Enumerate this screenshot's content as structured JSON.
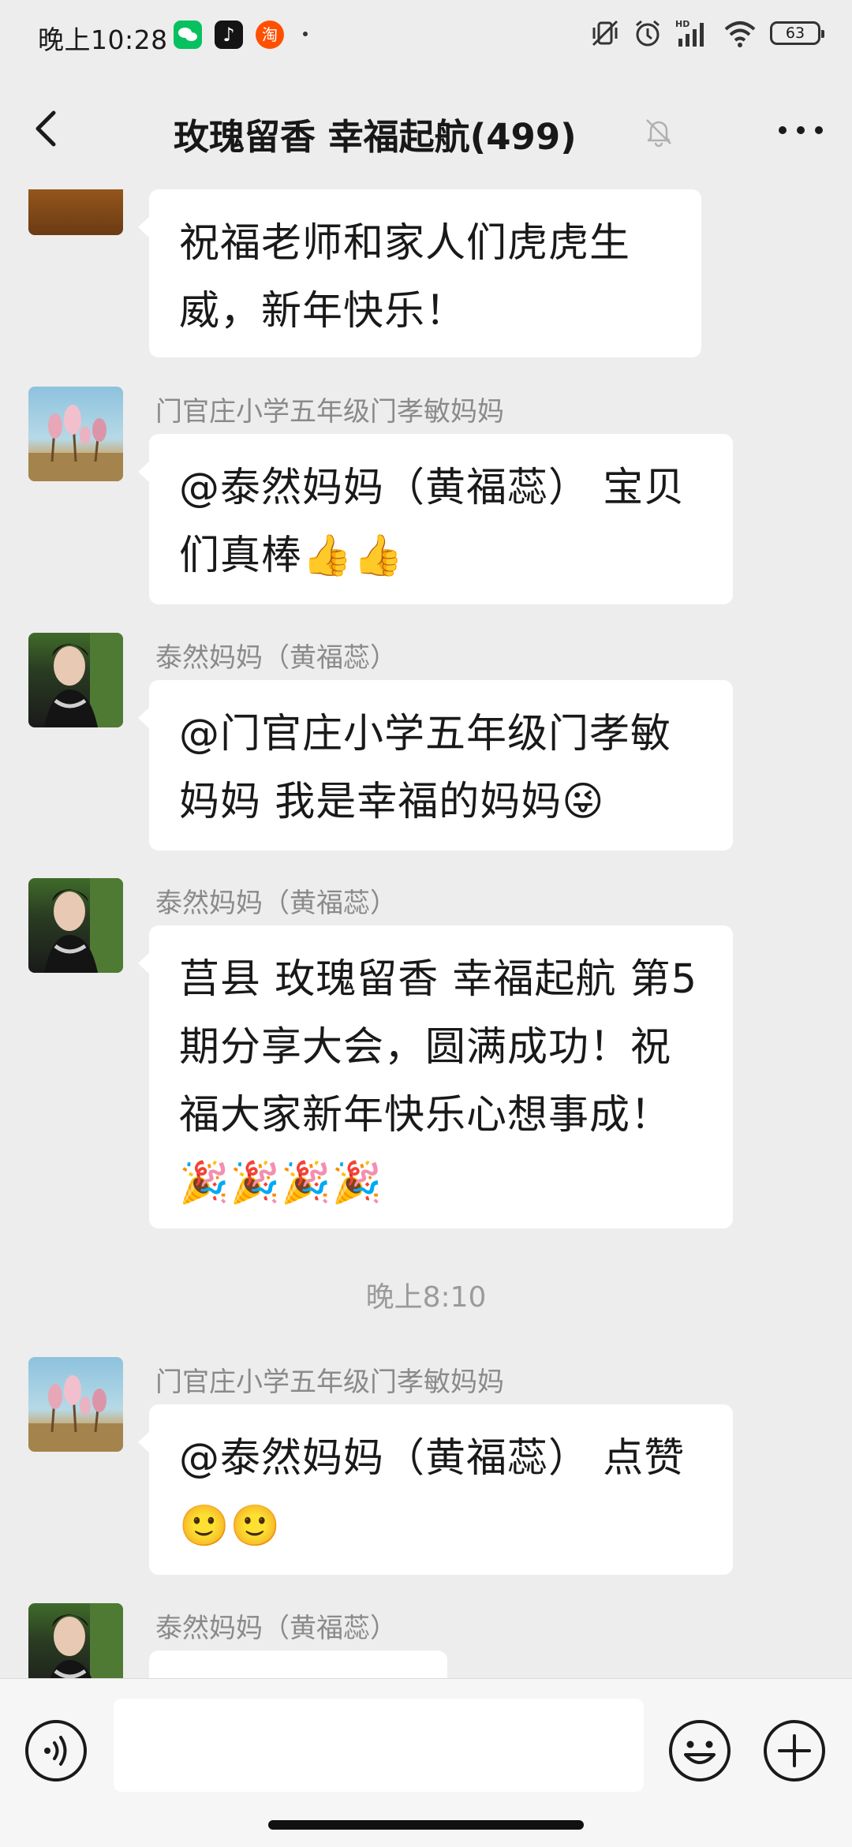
{
  "status_bar": {
    "time": "晚上10:28",
    "battery": "63",
    "taobao_glyph": "淘",
    "tiktok_glyph": "♪"
  },
  "header": {
    "title": "玫瑰留香  幸福起航(499)",
    "back_icon": "chevron-left-icon",
    "mute_icon": "bell-off-icon",
    "more_icon": "more-dots-icon"
  },
  "messages": [
    {
      "sender": "",
      "text": "祝福老师和家人们虎虎生威，新年快乐！",
      "avatar": "autumn-tree"
    },
    {
      "sender": "门官庄小学五年级门孝敏妈妈",
      "text": "@泰然妈妈（黄福蕊） 宝贝们真棒👍👍",
      "avatar": "magnolia"
    },
    {
      "sender": "泰然妈妈（黄福蕊）",
      "text": "@门官庄小学五年级门孝敏妈妈  我是幸福的妈妈😜",
      "avatar": "woman"
    },
    {
      "sender": "泰然妈妈（黄福蕊）",
      "text": "莒县  玫瑰留香 幸福起航 第5 期分享大会，圆满成功！祝福大家新年快乐心想事成！🎉🎉🎉🎉",
      "avatar": "woman"
    },
    {
      "sender": "门官庄小学五年级门孝敏妈妈",
      "text": "@泰然妈妈（黄福蕊） 点赞🙂🙂",
      "avatar": "magnolia"
    },
    {
      "sender": "泰然妈妈（黄福蕊）",
      "text": "",
      "avatar": "woman"
    }
  ],
  "time_divider": "晚上8:10",
  "input": {
    "placeholder": "",
    "value": ""
  },
  "colors": {
    "background": "#ededed",
    "bubble": "#ffffff",
    "sender_name": "#8a8a8a",
    "wechat_green": "#07c160"
  }
}
